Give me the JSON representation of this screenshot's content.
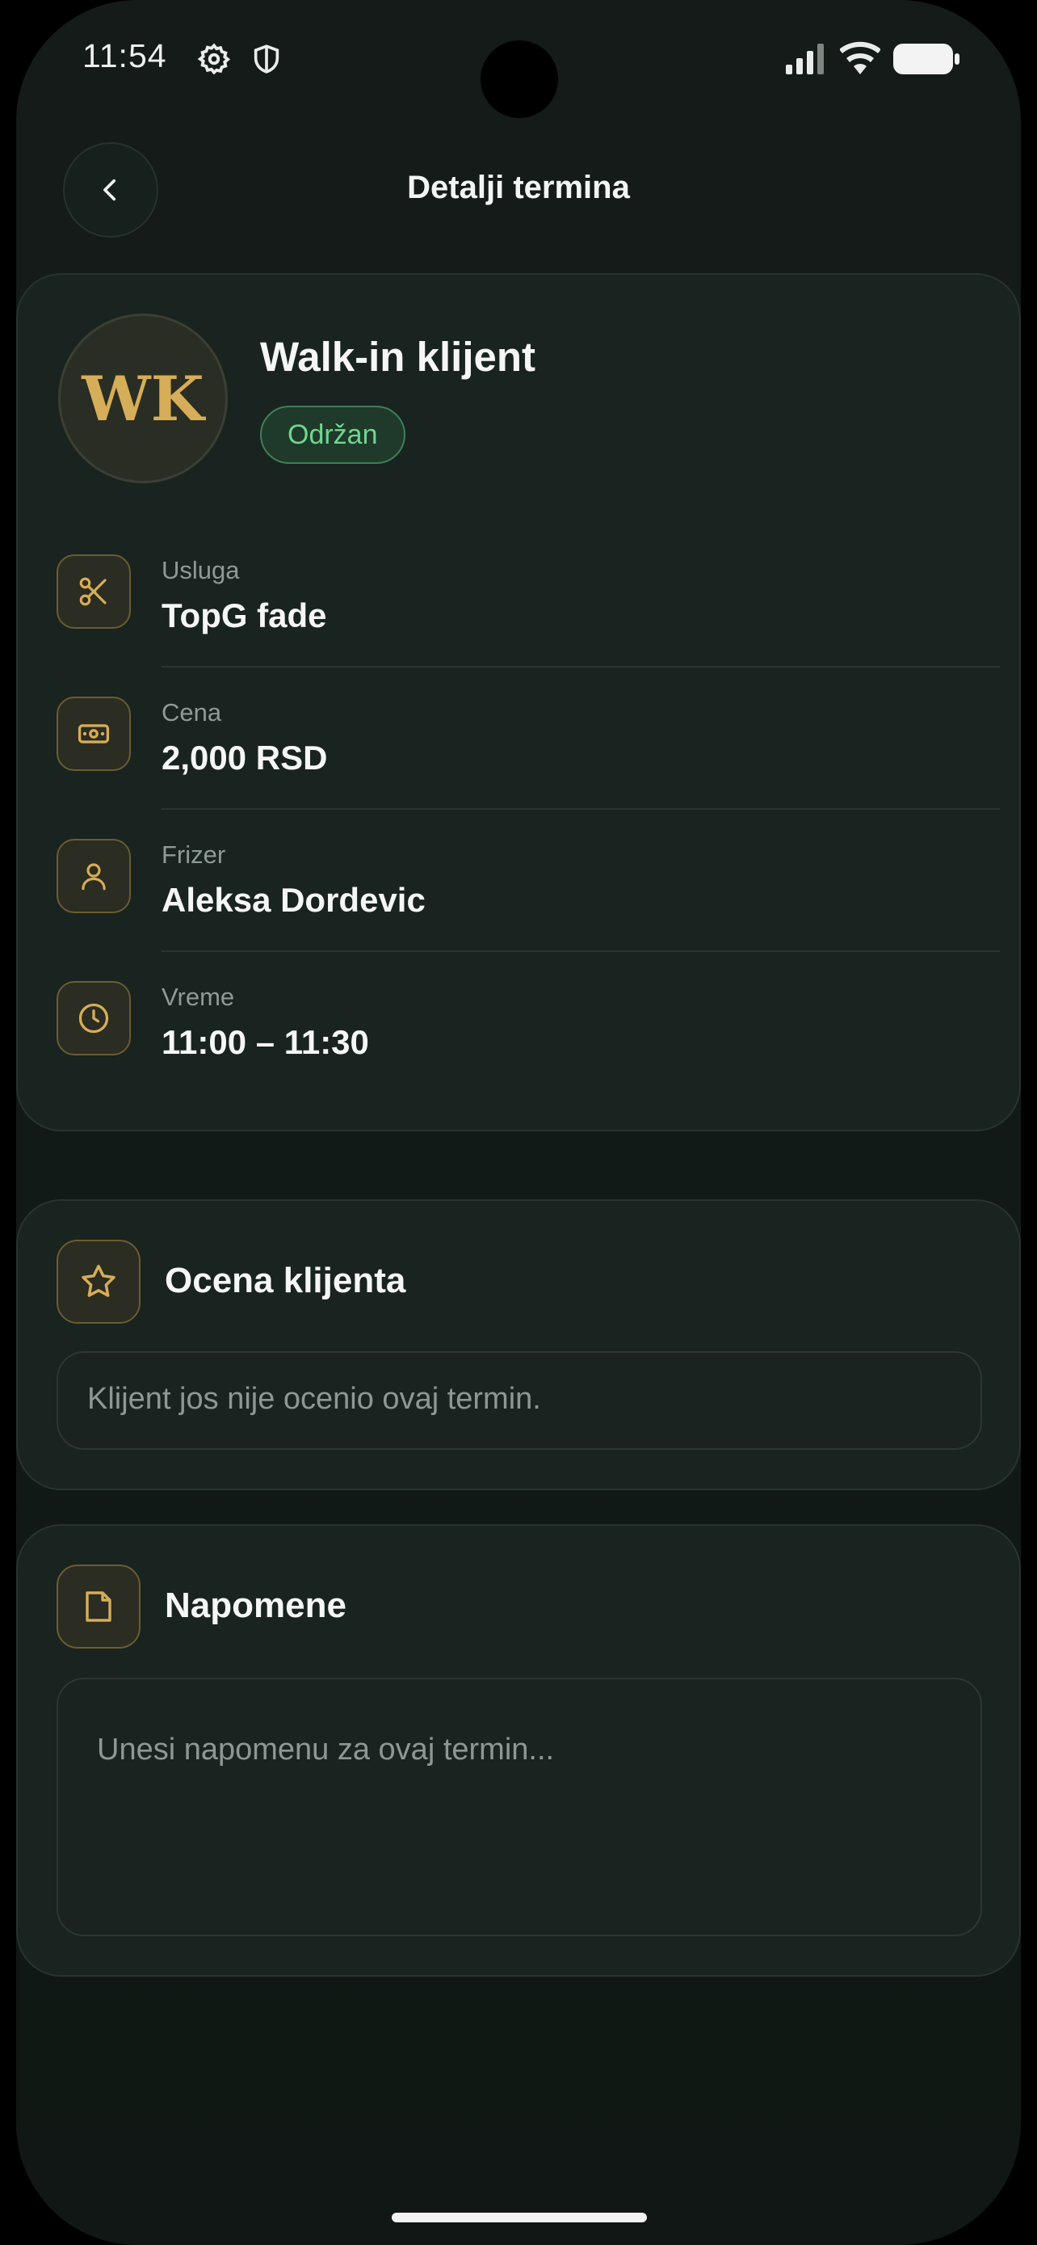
{
  "status_bar": {
    "time": "11:54",
    "icons": [
      "settings-icon",
      "shield-icon",
      "signal-icon",
      "wifi-icon",
      "battery-icon"
    ]
  },
  "header": {
    "back_icon": "chevron-left-icon",
    "title": "Detalji termina"
  },
  "client": {
    "initials": "WK",
    "name": "Walk-in klijent",
    "status": "Održan"
  },
  "details": [
    {
      "icon": "scissors-icon",
      "label": "Usluga",
      "value": "TopG fade"
    },
    {
      "icon": "cash-icon",
      "label": "Cena",
      "value": "2,000 RSD"
    },
    {
      "icon": "person-icon",
      "label": "Frizer",
      "value": "Aleksa Dordevic"
    },
    {
      "icon": "clock-icon",
      "label": "Vreme",
      "value": "11:00 – 11:30"
    }
  ],
  "rating": {
    "icon": "star-icon",
    "title": "Ocena klijenta",
    "message": "Klijent jos nije ocenio ovaj termin."
  },
  "notes": {
    "icon": "note-icon",
    "title": "Napomene",
    "placeholder": "Unesi napomenu za ovaj termin...",
    "value": ""
  },
  "colors": {
    "accent_gold": "#d6ad58",
    "status_green": "#6ed68f",
    "background": "#131a17",
    "card": "#19231f"
  }
}
